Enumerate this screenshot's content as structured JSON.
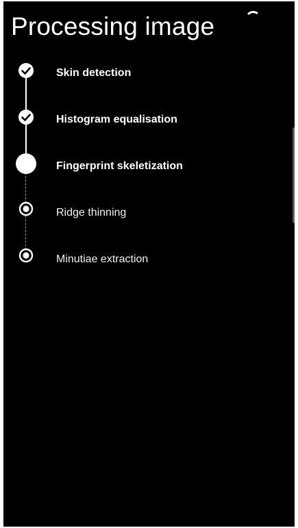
{
  "header": {
    "title": "Processing image"
  },
  "steps": [
    {
      "label": "Skin detection",
      "status": "done"
    },
    {
      "label": "Histogram equalisation",
      "status": "done"
    },
    {
      "label": "Fingerprint skeletization",
      "status": "active"
    },
    {
      "label": "Ridge thinning",
      "status": "pending"
    },
    {
      "label": "Minutiae extraction",
      "status": "pending"
    }
  ],
  "icons": {
    "done": "checkmark-circle-icon",
    "active": "filled-circle-icon",
    "pending": "radio-circle-icon",
    "loading": "loading-spinner-icon"
  },
  "colors": {
    "background": "#000000",
    "foreground": "#ffffff",
    "pending_line": "#9a9a9a"
  }
}
